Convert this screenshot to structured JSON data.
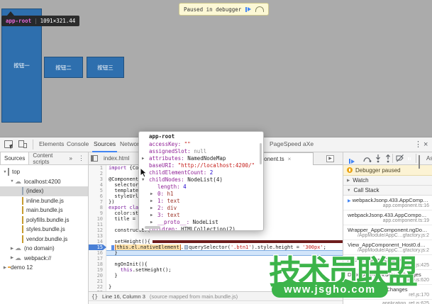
{
  "page": {
    "background": "#ababab",
    "highlight_tooltip": {
      "tag": "app-root",
      "sep": "|",
      "dims": "1091×321.44"
    },
    "paused_banner": {
      "label": "Paused in debugger"
    },
    "buttons": [
      {
        "label": "按钮一"
      },
      {
        "label": "按钮二"
      },
      {
        "label": "按钮三"
      }
    ]
  },
  "devtools": {
    "accent": "#4285f4",
    "main_toolbar": {
      "tabs": [
        {
          "label": "Elements"
        },
        {
          "label": "Console"
        },
        {
          "label": "Sources",
          "active": true
        },
        {
          "label": "Network"
        },
        {
          "label": "PageSpeed"
        },
        {
          "label": "aXe"
        }
      ],
      "more_icon": "⋮",
      "close_icon": "×"
    },
    "navigator": {
      "tabs": [
        {
          "label": "Sources",
          "active": true
        },
        {
          "label": "Content scripts"
        },
        {
          "label": "»"
        }
      ],
      "more_icon": "⋮",
      "tree": [
        {
          "label": "top",
          "icon": "frame",
          "depth": 0,
          "arrow": "▼"
        },
        {
          "label": "localhost:4200",
          "icon": "cloud",
          "depth": 1,
          "arrow": "▼"
        },
        {
          "label": "(index)",
          "icon": "page",
          "depth": 2,
          "arrow": "",
          "selected": true
        },
        {
          "label": "inline.bundle.js",
          "icon": "script",
          "depth": 2,
          "arrow": ""
        },
        {
          "label": "main.bundle.js",
          "icon": "script",
          "depth": 2,
          "arrow": ""
        },
        {
          "label": "polyfills.bundle.js",
          "icon": "script",
          "depth": 2,
          "arrow": ""
        },
        {
          "label": "styles.bundle.js",
          "icon": "script",
          "depth": 2,
          "arrow": ""
        },
        {
          "label": "vendor.bundle.js",
          "icon": "script",
          "depth": 2,
          "arrow": ""
        },
        {
          "label": "(no domain)",
          "icon": "cloud",
          "depth": 1,
          "arrow": "▶"
        },
        {
          "label": "webpack://",
          "icon": "cloud",
          "depth": 1,
          "arrow": "▶"
        },
        {
          "label": "demo 12",
          "icon": "folder",
          "depth": 0,
          "arrow": "▶"
        }
      ]
    },
    "editor": {
      "tabs": [
        {
          "label": "index.html"
        },
        {
          "label": "app.component.ts",
          "active": true,
          "close": "×"
        }
      ],
      "lines": [
        {
          "n": 1,
          "seg": [
            {
              "t": "import ",
              "c": "kw"
            },
            {
              "t": "{Comp",
              "c": "pl"
            }
          ]
        },
        {
          "n": 2,
          "seg": []
        },
        {
          "n": 3,
          "seg": [
            {
              "t": "@Component({",
              "c": "pl"
            }
          ]
        },
        {
          "n": 4,
          "seg": [
            {
              "t": "  selector: ",
              "c": "pl"
            }
          ]
        },
        {
          "n": 5,
          "seg": [
            {
              "t": "  templateUr",
              "c": "pl"
            }
          ]
        },
        {
          "n": 6,
          "seg": [
            {
              "t": "  styleUrls:",
              "c": "pl"
            }
          ]
        },
        {
          "n": 7,
          "seg": [
            {
              "t": "})",
              "c": "pl"
            }
          ]
        },
        {
          "n": 8,
          "seg": [
            {
              "t": "export class",
              "c": "kw"
            }
          ]
        },
        {
          "n": 9,
          "seg": [
            {
              "t": "  color:str",
              "c": "pl"
            }
          ]
        },
        {
          "n": 10,
          "seg": [
            {
              "t": "  title = ",
              "c": "pl"
            },
            {
              "t": "'",
              "c": "str"
            }
          ]
        },
        {
          "n": 11,
          "seg": []
        },
        {
          "n": 12,
          "seg": [
            {
              "t": "  constructor(",
              "c": "pl"
            }
          ]
        },
        {
          "n": 13,
          "seg": []
        },
        {
          "n": 14,
          "redbar": true,
          "seg": [
            {
              "t": "  setHeight(){",
              "c": "pl"
            }
          ]
        },
        {
          "n": 15,
          "bp": true,
          "seg": [
            {
              "t": " ",
              "c": "pl"
            },
            {
              "type": "caret"
            },
            {
              "type": "box",
              "t": "this.el.nativeElement"
            },
            {
              "t": ".",
              "c": "pl"
            },
            {
              "type": "objmark"
            },
            {
              "t": "querySelector(",
              "c": "pl"
            },
            {
              "t": "'.btn1'",
              "c": "str"
            },
            {
              "t": ").style.height = ",
              "c": "pl"
            },
            {
              "t": "'300px'",
              "c": "str"
            },
            {
              "t": ";",
              "c": "pl"
            }
          ]
        },
        {
          "n": 16,
          "exec": true,
          "seg": [
            {
              "t": "  }",
              "c": "pl"
            }
          ]
        },
        {
          "n": 17,
          "seg": []
        },
        {
          "n": 18,
          "seg": [
            {
              "t": "  ngOnInit(){",
              "c": "pl"
            }
          ]
        },
        {
          "n": 19,
          "seg": [
            {
              "t": "    ",
              "c": "pl"
            },
            {
              "t": "this",
              "c": "kw"
            },
            {
              "t": ".setHeight();",
              "c": "pl"
            }
          ]
        },
        {
          "n": 20,
          "seg": [
            {
              "t": "  }",
              "c": "pl"
            }
          ]
        },
        {
          "n": 21,
          "seg": []
        },
        {
          "n": 22,
          "seg": [
            {
              "t": "}",
              "c": "pl"
            }
          ]
        },
        {
          "n": 23,
          "seg": []
        },
        {
          "n": 24,
          "seg": []
        }
      ],
      "status": {
        "icon": "{}",
        "position": "Line 16, Column 3",
        "mapping": "(source mapped from main.bundle.js)"
      }
    },
    "object_popup": {
      "title": "app-root",
      "props": [
        {
          "k": "accessKey",
          "v": "\"\"",
          "vc": "vstr",
          "arrow": ""
        },
        {
          "k": "assignedSlot",
          "v": "null",
          "vc": "vnul",
          "arrow": ""
        },
        {
          "k": "attributes",
          "v": "NamedNodeMap",
          "vc": "vobj",
          "arrow": "▶"
        },
        {
          "k": "baseURI",
          "v": "\"http://localhost:4200/\"",
          "vc": "vstr",
          "arrow": ""
        },
        {
          "k": "childElementCount",
          "v": "2",
          "vc": "vnum",
          "arrow": ""
        },
        {
          "k": "childNodes",
          "v": "NodeList(4)",
          "vc": "vobj",
          "arrow": "▼"
        },
        {
          "k": "length",
          "v": "4",
          "vc": "vnum",
          "arrow": "",
          "child": true
        },
        {
          "k": "0",
          "v": "h1",
          "vc": "vnode",
          "arrow": "▶",
          "child": true
        },
        {
          "k": "1",
          "v": "text",
          "vc": "vnode",
          "arrow": "▶",
          "child": true
        },
        {
          "k": "2",
          "v": "div",
          "vc": "vnode",
          "arrow": "▶",
          "child": true
        },
        {
          "k": "3",
          "v": "text",
          "vc": "vnode",
          "arrow": "▶",
          "child": true
        },
        {
          "k": "__proto__",
          "v": "NodeList",
          "vc": "vobj",
          "arrow": "▶",
          "child": true
        },
        {
          "k": "children",
          "v": "HTMLCollection(2)",
          "vc": "vobj",
          "arrow": "▶"
        }
      ]
    },
    "debugger": {
      "paused_label": "Debugger paused",
      "async_label": "Async",
      "sections": [
        {
          "label": "Watch",
          "arrow": "▶"
        },
        {
          "label": "Call Stack",
          "arrow": "▼"
        }
      ],
      "call_stack": [
        {
          "name": "webpackJsonp.433.AppCompo…",
          "loc": "app.component.ts:16",
          "active": true
        },
        {
          "name": "webpackJsonp.433.AppCompo…",
          "loc": "app.component.ts:19"
        },
        {
          "name": "Wrapper_AppComponent.ngDo…",
          "loc": "/AppModule/AppC…gfactory.js:2"
        },
        {
          "name": "View_AppComponent_Host0.d…",
          "loc": "/AppModule/AppC…gfactory.js:2"
        },
        {
          "name": "AppView.detectChanges",
          "loc": "view.js:425"
        },
        {
          "name": "DebugAppView.detectChanges",
          "loc": "view.js:620"
        },
        {
          "name": "ViewRef_.detectChanges",
          "loc": "ref.js:170"
        },
        {
          "name": "",
          "loc": "application_ref.js:625"
        }
      ]
    }
  },
  "watermark": {
    "cn": "技术员联盟",
    "url": "www.jsgho.com"
  }
}
